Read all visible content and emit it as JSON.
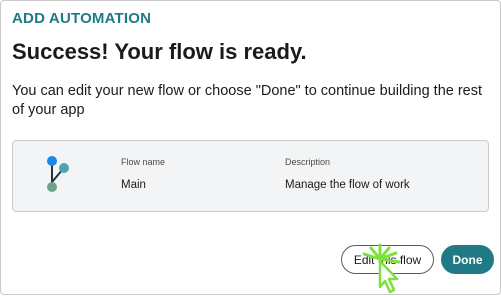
{
  "dialog": {
    "eyebrow": "ADD AUTOMATION",
    "title": "Success! Your flow is ready.",
    "description": "You can edit your new flow or choose \"Done\" to continue building the rest of your app"
  },
  "flow_card": {
    "icon": "flow-branch-icon",
    "name_label": "Flow name",
    "name_value": "Main",
    "description_label": "Description",
    "description_value": "Manage the flow of work"
  },
  "actions": {
    "edit_label": "Edit this flow",
    "done_label": "Done"
  },
  "colors": {
    "accent": "#1f7a86",
    "icon_blue": "#1e88e5",
    "icon_teal": "#4fa3b4",
    "icon_green": "#6aa389",
    "click_highlight": "#7ee03d"
  }
}
